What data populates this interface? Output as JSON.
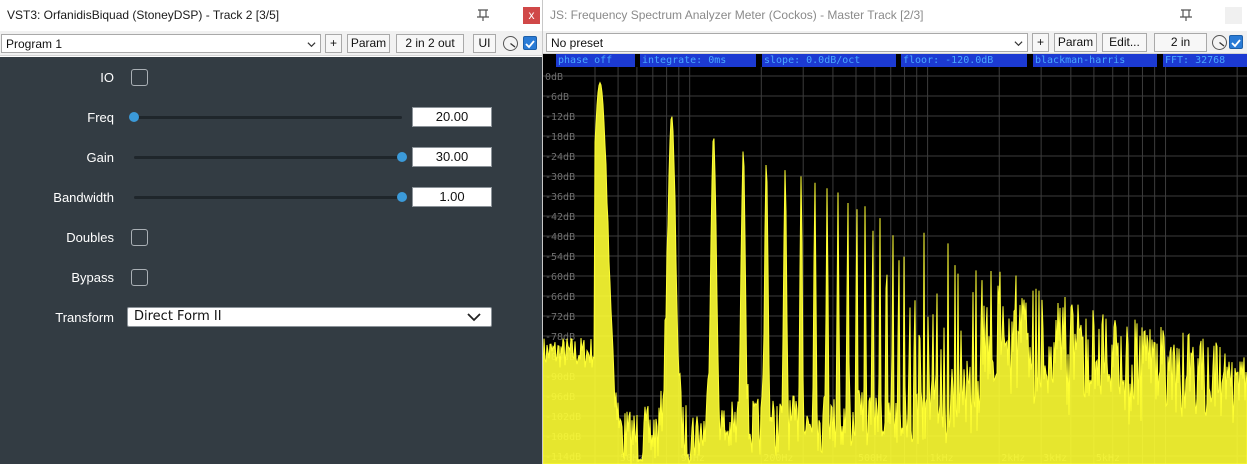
{
  "left_window": {
    "title": "VST3: OrfanidisBiquad (StoneyDSP) - Track 2 [3/5]",
    "close_label": "x",
    "preset": "Program 1",
    "buttons": {
      "add": "+",
      "param": "Param",
      "io": "2 in 2 out",
      "ui": "UI"
    },
    "params": {
      "io": {
        "label": "IO",
        "checked": false
      },
      "freq": {
        "label": "Freq",
        "value": "20.00",
        "fraction": 0.0
      },
      "gain": {
        "label": "Gain",
        "value": "30.00",
        "fraction": 1.0
      },
      "bandwidth": {
        "label": "Bandwidth",
        "value": "1.00",
        "fraction": 1.0
      },
      "doubles": {
        "label": "Doubles",
        "checked": false
      },
      "bypass": {
        "label": "Bypass",
        "checked": false
      },
      "transform": {
        "label": "Transform",
        "value": "Direct Form II"
      }
    }
  },
  "right_window": {
    "title": "JS: Frequency Spectrum Analyzer Meter (Cockos) - Master Track [2/3]",
    "preset": "No preset",
    "buttons": {
      "add": "+",
      "param": "Param",
      "edit": "Edit...",
      "io": "2 in"
    },
    "info_bar": [
      "phase off",
      "integrate: 0ms",
      "slope: 0.0dB/oct",
      "floor: -120.0dB",
      "blackman-harris",
      "FFT: 32768"
    ],
    "db_labels": [
      "0dB",
      "-6dB",
      "-12dB",
      "-18dB",
      "-24dB",
      "-30dB",
      "-36dB",
      "-42dB",
      "-48dB",
      "-54dB",
      "-60dB",
      "-66dB",
      "-72dB",
      "-78dB",
      "-84dB",
      "-90dB",
      "-96dB",
      "-102dB",
      "-108dB",
      "-114dB"
    ],
    "freq_labels": [
      "50Hz",
      "90Hz",
      "200Hz",
      "500Hz",
      "1kHz",
      "2kHz",
      "3kHz",
      "5kHz"
    ]
  },
  "colors": {
    "plugin_bg": "#333c43",
    "slider_thumb": "#3b9ad9",
    "spectrum": "#ffff33",
    "grid": "#3c3c3c",
    "info_bg": "#1c3ad2",
    "info_text": "#4aa8ff",
    "close_red": "#d04848",
    "check_blue": "#2a7bd6"
  }
}
